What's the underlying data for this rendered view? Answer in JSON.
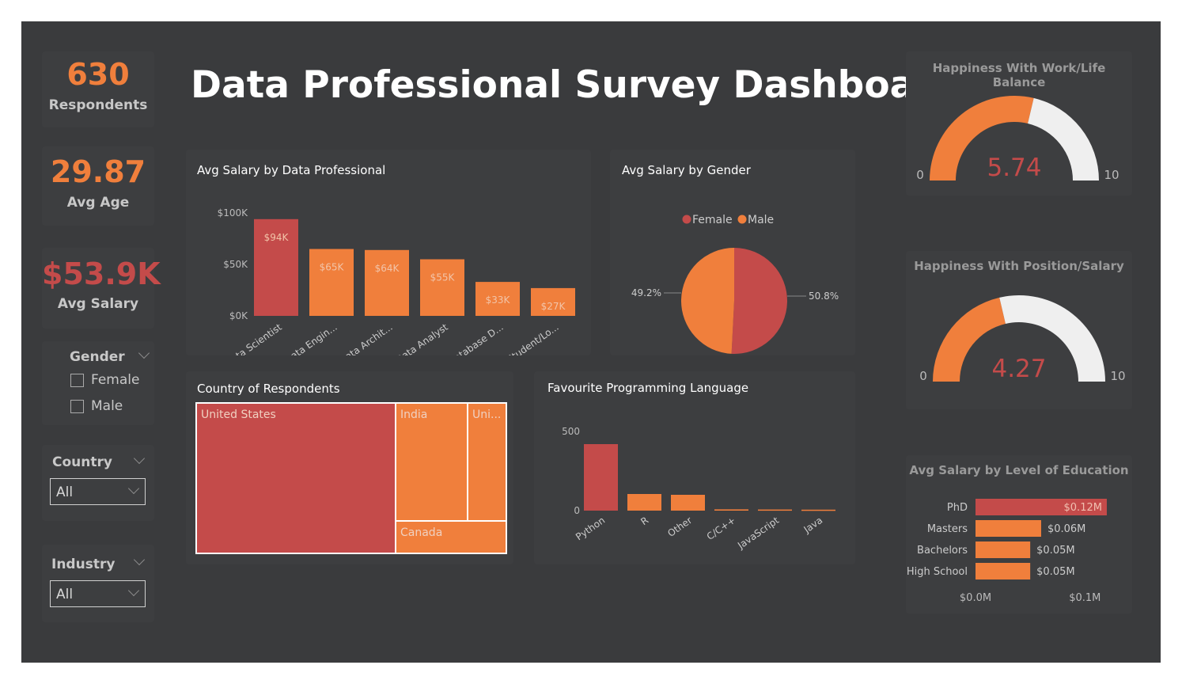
{
  "colors": {
    "orange": "#f07f3c",
    "red": "#c44b4a",
    "grey_arc": "#efefef",
    "canvas": "#3a3b3d"
  },
  "kpis": [
    {
      "value": "630",
      "label": "Respondents",
      "color": "#f07f3c"
    },
    {
      "value": "29.87",
      "label": "Avg Age",
      "color": "#f07f3c"
    },
    {
      "value": "$53.9K",
      "label": "Avg Salary",
      "color": "#c44b4a"
    }
  ],
  "filters": {
    "gender": {
      "title": "Gender",
      "options": [
        "Female",
        "Male"
      ]
    },
    "country": {
      "title": "Country",
      "selected": "All"
    },
    "industry": {
      "title": "Industry",
      "selected": "All"
    }
  },
  "dashboard_title": "Data Professional Survey Dashboard",
  "chart_data": [
    {
      "id": "salary_by_role",
      "type": "bar",
      "title": "Avg Salary by Data Professional",
      "categories": [
        "Data Scientist",
        "Data Engin...",
        "Data Archit...",
        "Data Analyst",
        "Database D...",
        "Student/Lo..."
      ],
      "values": [
        94,
        65,
        64,
        55,
        33,
        27
      ],
      "data_labels": [
        "$94K",
        "$65K",
        "$64K",
        "$55K",
        "$33K",
        "$27K"
      ],
      "ytick_labels": [
        "$100K",
        "$50K",
        "$0K"
      ],
      "yticks": [
        100,
        50,
        0
      ],
      "ylim": [
        0,
        100
      ],
      "highlight_index": 0
    },
    {
      "id": "salary_by_gender",
      "type": "pie",
      "title": "Avg Salary by Gender",
      "legend": [
        "Female",
        "Male"
      ],
      "values": [
        50.8,
        49.2
      ],
      "labels": [
        "50.8%",
        "49.2%"
      ]
    },
    {
      "id": "country",
      "type": "treemap",
      "title": "Country of Respondents",
      "labels": [
        "United States",
        "India",
        "Uni...",
        "Canada"
      ]
    },
    {
      "id": "language",
      "type": "bar",
      "title": "Favourite Programming Language",
      "categories": [
        "Python",
        "R",
        "Other",
        "C/C++",
        "JavaScript",
        "Java"
      ],
      "values": [
        420,
        105,
        100,
        8,
        7,
        6
      ],
      "ytick_labels": [
        "500",
        "0"
      ],
      "yticks": [
        500,
        0
      ],
      "ylim": [
        0,
        500
      ],
      "highlight_index": 0
    },
    {
      "id": "happiness_work_life",
      "type": "gauge",
      "title": "Happiness With Work/Life Balance",
      "value": 5.74,
      "value_label": "5.74",
      "min": 0,
      "max": 10,
      "min_label": "0",
      "max_label": "10"
    },
    {
      "id": "happiness_position_salary",
      "type": "gauge",
      "title": "Happiness With Position/Salary",
      "value": 4.27,
      "value_label": "4.27",
      "min": 0,
      "max": 10,
      "min_label": "0",
      "max_label": "10"
    },
    {
      "id": "salary_by_education",
      "type": "bar",
      "orientation": "horizontal",
      "title": "Avg Salary by Level of Education",
      "categories": [
        "PhD",
        "Masters",
        "Bachelors",
        "High School"
      ],
      "values": [
        0.12,
        0.06,
        0.05,
        0.05
      ],
      "data_labels": [
        "$0.12M",
        "$0.06M",
        "$0.05M",
        "$0.05M"
      ],
      "xtick_labels": [
        "$0.0M",
        "$0.1M"
      ],
      "xticks": [
        0,
        0.1
      ],
      "highlight_index": 0
    }
  ]
}
